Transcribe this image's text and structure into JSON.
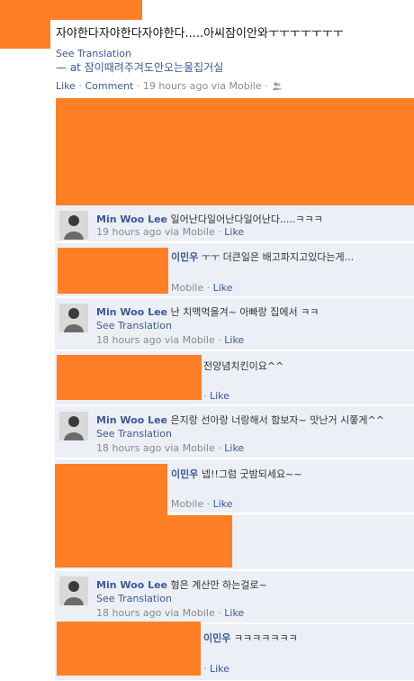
{
  "post": {
    "text": "자야한다자야한다자야한다.....아씨잠이안와ㅜㅜㅜㅜㅜㅜㅜ",
    "see_translation": "See Translation",
    "place_line": "— at 잠이때려주겨도안오는울집거실",
    "actions": {
      "like": "Like",
      "comment": "Comment",
      "time": "19 hours ago via Mobile",
      "separator": "·",
      "audience_icon": "friends-icon"
    }
  },
  "comments": [
    {
      "author": "Min Woo Lee",
      "text": "일어난다일어난다일어난다.....ㅋㅋㅋ",
      "time": "19 hours ago via Mobile",
      "like": "Like"
    },
    {
      "author": "이민우",
      "text": "ㅜㅜ 더큰일은 배고파지고있다는게...",
      "time": "Mobile",
      "like": "Like"
    },
    {
      "author": "Min Woo Lee",
      "text": "난 치맥먹을겨~ 아빠랑 집에서 ㅋㅋ",
      "see_translation": "See Translation",
      "time": "18 hours ago via Mobile",
      "like": "Like"
    },
    {
      "text": "전양념치킨이요^^",
      "like": "Like"
    },
    {
      "author": "Min Woo Lee",
      "text": "은지랑 선아랑 너랑해서 함보자~ 맛난거 시쫗게^^",
      "see_translation": "See Translation",
      "time": "18 hours ago via Mobile",
      "like": "Like"
    },
    {
      "author": "이민우",
      "text": "넵!!그럼 굿밤되세요~~",
      "time": "Mobile",
      "like": "Like"
    },
    {
      "author": "Min Woo Lee",
      "text": "형은 계산만 하는걸로~",
      "see_translation": "See Translation",
      "time": "18 hours ago via Mobile",
      "like": "Like"
    },
    {
      "author": "이민우",
      "text": "ㅋㅋㅋㅋㅋㅋㅋ",
      "like": "Like"
    }
  ],
  "colors": {
    "link": "#3b5998",
    "comment_bg": "#eceff5",
    "meta": "#8a8a8a",
    "redaction": "#ff7f27"
  }
}
